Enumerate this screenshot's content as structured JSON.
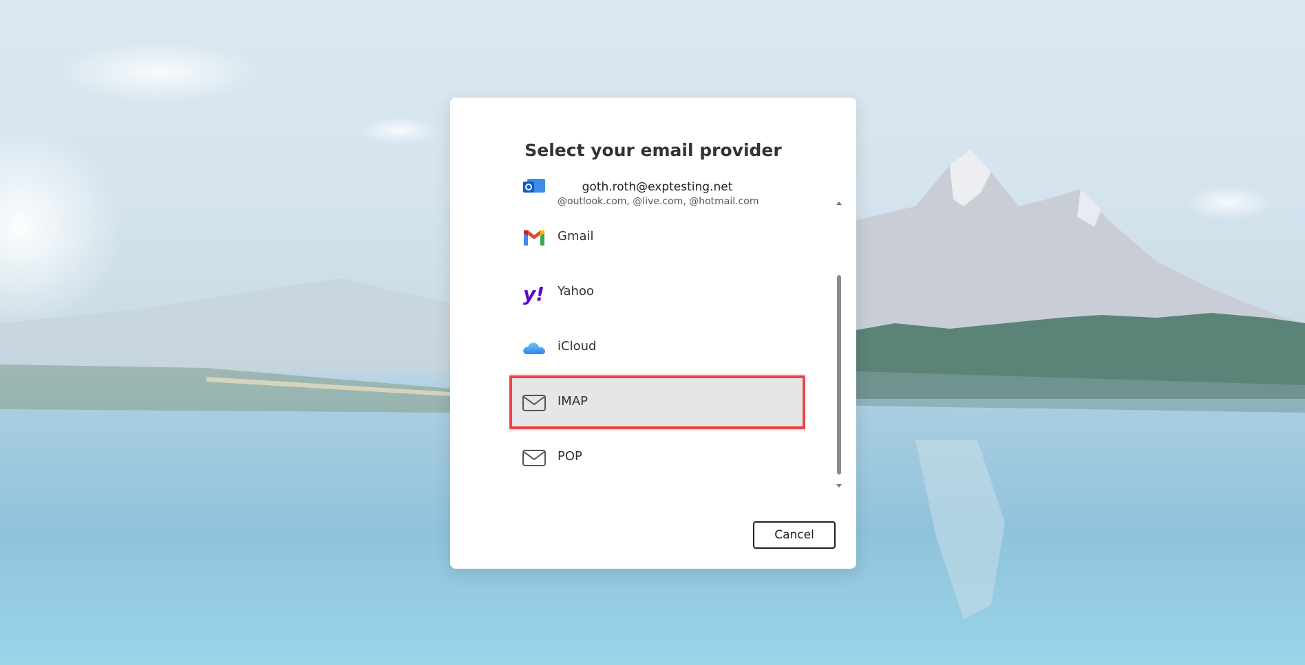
{
  "dialog": {
    "title": "Select your email provider",
    "cancel_label": "Cancel"
  },
  "providers": [
    {
      "icon": "outlook-icon",
      "email": "goth.roth@exptesting.net",
      "label": "@outlook.com, @live.com, @hotmail.com"
    },
    {
      "icon": "gmail-icon",
      "label": "Gmail"
    },
    {
      "icon": "yahoo-icon",
      "label": "Yahoo"
    },
    {
      "icon": "icloud-icon",
      "label": "iCloud"
    },
    {
      "icon": "envelope-icon",
      "label": "IMAP",
      "selected": true
    },
    {
      "icon": "envelope-icon",
      "label": "POP"
    }
  ],
  "colors": {
    "highlight_border": "#e8464a",
    "selected_background": "#e6e6e6",
    "yahoo_purple": "#6001d2",
    "icloud_blue": "#3a9bf0"
  }
}
